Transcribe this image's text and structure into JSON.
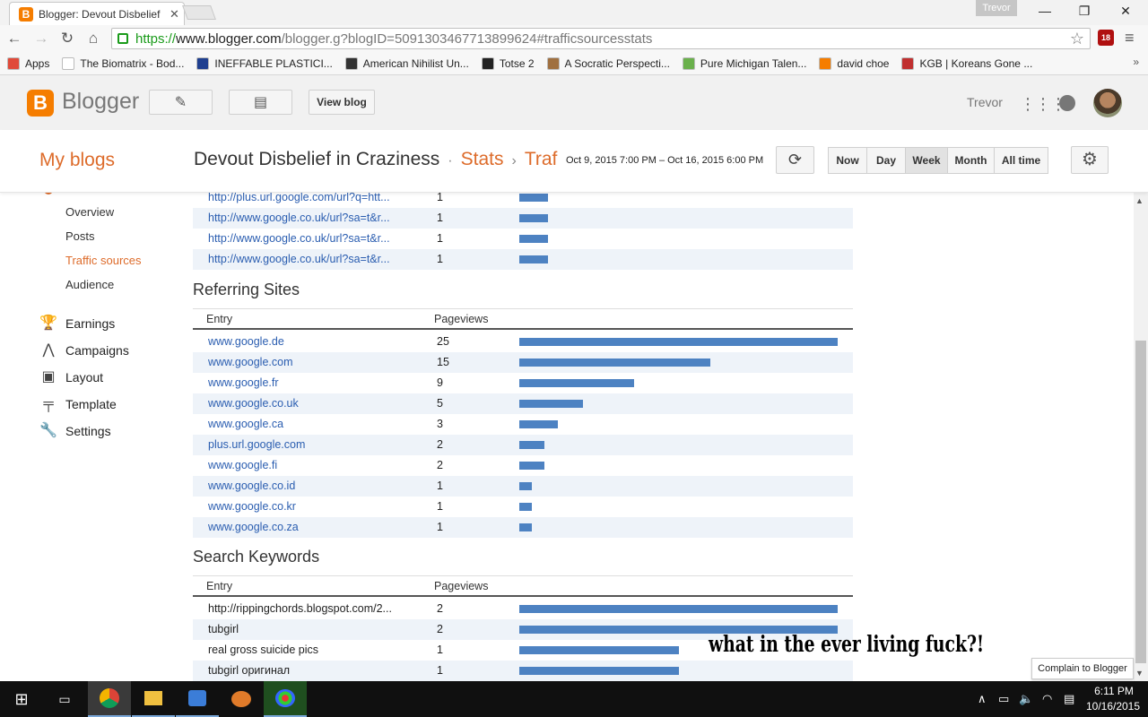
{
  "browser": {
    "tab_title": "Blogger: Devout Disbelief",
    "tab_close": "✕",
    "profile_name": "Trevor",
    "window_controls": [
      "—",
      "❐",
      "✕"
    ],
    "url_secure": "https://",
    "url_host": "www.blogger.com",
    "url_rest": "/blogger.g?blogID=5091303467713899624#trafficsourcesstats",
    "ext_badge": "18",
    "bookmarks": [
      {
        "label": "Apps",
        "icon_color": "#e04a3a",
        "icon": "grid-icon"
      },
      {
        "label": "The Biomatrix - Bod...",
        "icon_color": "#ffffff",
        "icon": "page-icon"
      },
      {
        "label": "INEFFABLE PLASTICI...",
        "icon_color": "#1f3f8f",
        "icon": "grid-icon"
      },
      {
        "label": "American Nihilist Un...",
        "icon_color": "#333333",
        "icon": "trident-icon"
      },
      {
        "label": "Totse 2",
        "icon_color": "#222222",
        "icon": "spiral-icon"
      },
      {
        "label": "A Socratic Perspecti...",
        "icon_color": "#a07040",
        "icon": "portrait-icon"
      },
      {
        "label": "Pure Michigan Talen...",
        "icon_color": "#6ab04c",
        "icon": "m-icon"
      },
      {
        "label": "david choe",
        "icon_color": "#f57d00",
        "icon": "blogger-icon"
      },
      {
        "label": "KGB | Koreans Gone ...",
        "icon_color": "#c03030",
        "icon": "flag-icon"
      }
    ],
    "bookmarks_more": "»"
  },
  "blogger": {
    "brand": "Blogger",
    "logo_letter": "B",
    "view_blog": "View blog",
    "user": "Trevor",
    "my_blogs": "My blogs",
    "blog_name": "Devout Disbelief in Craziness",
    "dot": "·",
    "crumb_stats": "Stats",
    "crumb_arrow": "›",
    "crumb_traffic": "Traf",
    "date_range": "Oct 9, 2015 7:00 PM – Oct 16, 2015 6:00 PM",
    "periods": [
      "Now",
      "Day",
      "Week",
      "Month",
      "All time"
    ],
    "active_period": "Week"
  },
  "sidebar": {
    "stats_sub": [
      "Overview",
      "Posts",
      "Traffic sources",
      "Audience"
    ],
    "active_sub": "Traffic sources",
    "main": [
      {
        "label": "Earnings",
        "icon": "trophy-icon",
        "glyph": "🏆"
      },
      {
        "label": "Campaigns",
        "icon": "campaigns-icon",
        "glyph": "⋀"
      },
      {
        "label": "Layout",
        "icon": "layout-icon",
        "glyph": "▣"
      },
      {
        "label": "Template",
        "icon": "template-icon",
        "glyph": "╤"
      },
      {
        "label": "Settings",
        "icon": "wrench-icon",
        "glyph": "🔧"
      }
    ]
  },
  "traffic": {
    "max_pageviews": 25,
    "top_urls": [
      {
        "entry": "http://plus.url.google.com/url?q=htt...",
        "pageviews": 1,
        "bar_fraction": 0.09
      },
      {
        "entry": "http://www.google.co.uk/url?sa=t&r...",
        "pageviews": 1,
        "bar_fraction": 0.09
      },
      {
        "entry": "http://www.google.co.uk/url?sa=t&r...",
        "pageviews": 1,
        "bar_fraction": 0.09
      },
      {
        "entry": "http://www.google.co.uk/url?sa=t&r...",
        "pageviews": 1,
        "bar_fraction": 0.09
      }
    ],
    "referring_title": "Referring Sites",
    "col_entry": "Entry",
    "col_pageviews": "Pageviews",
    "referring": [
      {
        "entry": "www.google.de",
        "pageviews": 25,
        "bar_fraction": 1.0
      },
      {
        "entry": "www.google.com",
        "pageviews": 15,
        "bar_fraction": 0.6
      },
      {
        "entry": "www.google.fr",
        "pageviews": 9,
        "bar_fraction": 0.36
      },
      {
        "entry": "www.google.co.uk",
        "pageviews": 5,
        "bar_fraction": 0.2
      },
      {
        "entry": "www.google.ca",
        "pageviews": 3,
        "bar_fraction": 0.12
      },
      {
        "entry": "plus.url.google.com",
        "pageviews": 2,
        "bar_fraction": 0.08
      },
      {
        "entry": "www.google.fi",
        "pageviews": 2,
        "bar_fraction": 0.08
      },
      {
        "entry": "www.google.co.id",
        "pageviews": 1,
        "bar_fraction": 0.04
      },
      {
        "entry": "www.google.co.kr",
        "pageviews": 1,
        "bar_fraction": 0.04
      },
      {
        "entry": "www.google.co.za",
        "pageviews": 1,
        "bar_fraction": 0.04
      }
    ],
    "keywords_title": "Search Keywords",
    "keywords": [
      {
        "entry": "http://rippingchords.blogspot.com/2...",
        "pageviews": 2,
        "bar_fraction": 1.0
      },
      {
        "entry": "tubgirl",
        "pageviews": 2,
        "bar_fraction": 1.0
      },
      {
        "entry": "real gross suicide pics",
        "pageviews": 1,
        "bar_fraction": 0.5
      },
      {
        "entry": "tubgirl оригинал",
        "pageviews": 1,
        "bar_fraction": 0.5
      }
    ]
  },
  "overlay_caption": "what in the ever living fuck?!",
  "complain_button": "Complain to Blogger",
  "taskbar": {
    "time": "6:11 PM",
    "date": "10/16/2015"
  }
}
